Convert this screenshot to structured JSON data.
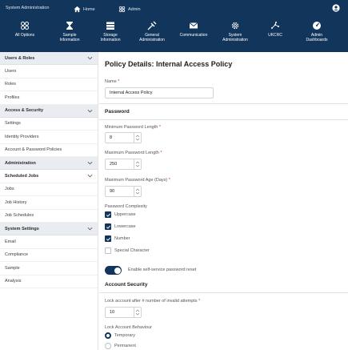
{
  "topbar": {
    "breadcrumbs": [
      "System Administration",
      "Home",
      "Admin"
    ],
    "nav": [
      {
        "label": "All Options",
        "icon": "all-options-icon"
      },
      {
        "label": "Sample\nInformation",
        "icon": "hourglass-icon"
      },
      {
        "label": "Storage\nInformation",
        "icon": "storage-icon"
      },
      {
        "label": "General\nAdministration",
        "icon": "general-admin-icon"
      },
      {
        "label": "Communication",
        "icon": "envelope-icon"
      },
      {
        "label": "System\nAdministration",
        "icon": "gear-icon"
      },
      {
        "label": "UKCRC",
        "icon": "network-icon"
      },
      {
        "label": "Admin\nDashboards",
        "icon": "dashboard-icon"
      }
    ]
  },
  "sidebar": {
    "sections": [
      {
        "label": "Users & Roles",
        "items": [
          "Users",
          "Roles",
          "Profiles"
        ]
      },
      {
        "label": "Access & Security",
        "items": [
          "Settings",
          "Identity Providers",
          "Account & Password Policies"
        ]
      },
      {
        "label": "Administration",
        "items": []
      },
      {
        "label": "Scheduled Jobs",
        "items": [
          "Jobs",
          "Job History",
          "Job Schedules"
        ]
      },
      {
        "label": "System Settings",
        "items": [
          "Email",
          "Compliance",
          "Sample",
          "Analysis"
        ]
      }
    ]
  },
  "main": {
    "title": "Policy Details: Internal Access Policy",
    "name_label": "Name",
    "name_value": "Internal Access Policy",
    "password_heading": "Password",
    "min_length_label": "Minimum Password Length",
    "min_length_value": "8",
    "max_length_label": "Maximum Password Length",
    "max_length_value": "250",
    "max_age_label": "Maximum Password Age (Days)",
    "max_age_value": "90",
    "complexity_label": "Password Complexity",
    "complexity": [
      {
        "label": "Uppercase",
        "checked": true
      },
      {
        "label": "Lowercase",
        "checked": true
      },
      {
        "label": "Number",
        "checked": true
      },
      {
        "label": "Special Character",
        "checked": false
      }
    ],
    "self_service_label": "Enable self-service password reset",
    "self_service_on": true,
    "account_security_heading": "Account Security",
    "lock_label": "Lock account after # number of invalid attempts",
    "lock_value": "10",
    "behaviour_label": "Lock Account Behaviour",
    "behaviour_options": [
      {
        "label": "Temporary",
        "selected": true
      },
      {
        "label": "Permanent",
        "selected": false
      }
    ],
    "required_marker": "*"
  },
  "colors": {
    "navy": "#12355b",
    "required": "#d0312d",
    "section_bg": "#e9ecf0"
  }
}
